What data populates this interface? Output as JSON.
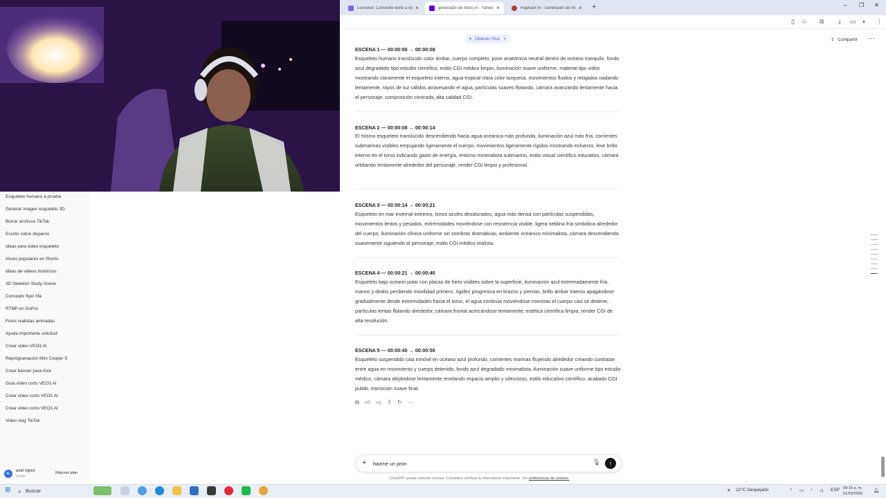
{
  "browser": {
    "tabs": [
      {
        "label": "Luvvoice: Convierte texto a voz",
        "icon_color": "#7b6be8",
        "active": false
      },
      {
        "label": "generador de fotos IA - Yahoo",
        "icon_color": "#6001d2",
        "active": true
      },
      {
        "label": "Raphael AI - Generador de ima",
        "icon_color": "#b0413e",
        "active": false
      }
    ],
    "new_tab_icon": "plus-icon",
    "window_controls": [
      "minimize-icon",
      "restore-icon",
      "close-icon"
    ]
  },
  "header": {
    "get_plus_label": "Obtener Plus",
    "share_label": "Compartir",
    "more_icon": "ellipsis-icon"
  },
  "sidebar": {
    "items": [
      "Esqueleto humano a prueba",
      "Generar imagen esqueleto 3D",
      "Borrar archivos TikTok",
      "Escrito sobre disparos",
      "Ideas para video esqueleto",
      "Voces populares en Shorts",
      "Ideas de videos históricos",
      "3D Skeleton Study Scene",
      "Concepto flyer rifa",
      "RTMP en GoPro",
      "Fotos realistas animadas",
      "Ayuda importante solicitud",
      "Crear video VEO3.AI",
      "Reprogramación Mini Cooper S",
      "Crear banner para Kick",
      "Guía video corto VEO3.AI",
      "Crear video corto VEO3.AI",
      "Crear video corto VEO3.AI",
      "Video vlog TikTok"
    ],
    "user": {
      "initials": "AL",
      "name": "axel lopez",
      "plan": "Gratis"
    },
    "upgrade_label": "Mejorar plan"
  },
  "scenes": [
    {
      "title": "ESCENA 1 — 00:00:00 → 00:00:08",
      "text": "Esqueleto humano translúcido color ámbar, cuerpo completo, pose anatómica neutral dentro de océano tranquilo, fondo azul degradado tipo estudio científico, estilo CGI médico limpio, iluminación suave uniforme, material tipo vidrio mostrando claramente el esqueleto interno, agua tropical clara color turquesa, movimientos fluidos y relajados nadando lentamente, rayos de luz cálidos atravesando el agua, partículas suaves flotando, cámara avanzando lentamente hacia el personaje, composición centrada, alta calidad CGI."
    },
    {
      "title": "ESCENA 2 — 00:00:08 → 00:00:14",
      "text": "El mismo esqueleto translúcido descendiendo hacia agua oceánica más profunda, iluminación azul más fría, corrientes submarinas visibles empujando ligeramente el cuerpo, movimientos ligeramente rígidos mostrando esfuerzo, leve brillo interno en el torso indicando gasto de energía, entorno minimalista submarino, estilo visual científico educativo, cámara orbitando lentamente alrededor del personaje, render CGI limpio y profesional."
    },
    {
      "title": "ESCENA 3 — 00:00:14 → 00:00:21",
      "text": "Esqueleto en mar invernal extremo, tonos azules desaturados, agua más densa con partículas suspendidas, movimientos lentos y pesados, extremidades moviéndose con resistencia visible, ligera neblina fría simbólica alrededor del cuerpo, iluminación clínica uniforme sin sombras dramáticas, ambiente oceánico minimalista, cámara descendiendo suavemente siguiendo al personaje, estilo CGI médico realista."
    },
    {
      "title": "ESCENA 4 — 00:00:21 → 00:00:40",
      "text": "Esqueleto bajo océano polar con placas de hielo visibles sobre la superficie, iluminación azul extremadamente fría, manos y dedos perdiendo movilidad primero, rigidez progresiva en brazos y piernas, brillo ámbar interno apagándose gradualmente desde extremidades hacia el torso, el agua continúa moviéndose mientras el cuerpo casi se detiene, partículas lentas flotando alrededor, cámara frontal acercándose lentamente, estética científica limpia, render CGI de alta resolución."
    },
    {
      "title": "ESCENA 5 — 00:00:40 → 00:00:50",
      "text": "Esqueleto suspendido casi inmóvil en océano azul profundo, corrientes marinas fluyendo alrededor creando contraste entre agua en movimiento y cuerpo detenido, fondo azul degradado minimalista, iluminación suave uniforme tipo estudio médico, cámara alejándose lentamente revelando espacio amplio y silencioso, estilo educativo científico, acabado CGI pulido, transición suave final."
    }
  ],
  "message_actions": [
    "copy-icon",
    "thumbs-up-icon",
    "thumbs-down-icon",
    "share-icon",
    "regenerate-icon",
    "more-icon"
  ],
  "composer": {
    "value": "hazme un pron",
    "disclaimer": "ChatGPT puede cometer errores. Considera verificar la información importante. Ver",
    "cookies_link": "preferencias de cookies."
  },
  "taskbar": {
    "search_label": "Buscar",
    "weather": "22°C  Despejado",
    "language": "ESP",
    "time": "09:16 p. m.",
    "date": "01/03/2026"
  }
}
